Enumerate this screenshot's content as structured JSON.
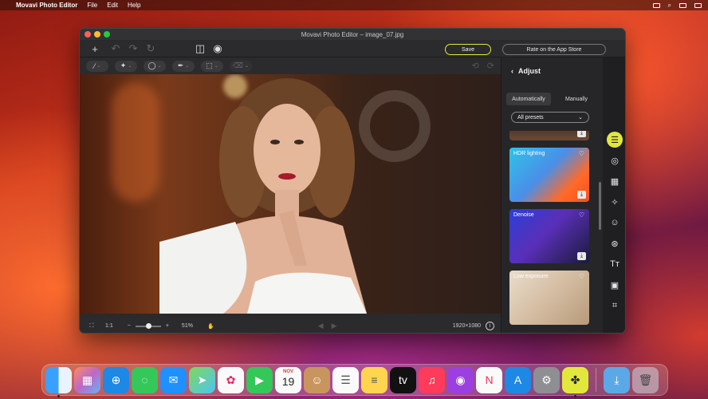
{
  "menubar": {
    "app_name": "Movavi Photo Editor",
    "items": [
      "File",
      "Edit",
      "Help"
    ]
  },
  "window": {
    "title": "Movavi Photo Editor – image_07.jpg"
  },
  "toolbar": {
    "save_label": "Save",
    "rate_label": "Rate on the App Store"
  },
  "statusbar": {
    "ratio": "1:1",
    "zoom_minus": "−",
    "zoom_plus": "+",
    "zoom_percent": "51%",
    "resolution": "1920×1080",
    "zoom_fraction": 0.51
  },
  "panel": {
    "title": "Adjust",
    "tabs": [
      "Automatically",
      "Manually"
    ],
    "active_tab": "Automatically",
    "preset_select": "All presets",
    "presets": [
      {
        "name": "HDR lighting"
      },
      {
        "name": "Denoise"
      },
      {
        "name": "Low exposure"
      }
    ]
  },
  "sidebar_icons": [
    "adjust-icon",
    "retouch-icon",
    "background-icon",
    "magic-icon",
    "face-icon",
    "filters-icon",
    "text-icon",
    "overlay-icon",
    "crop-icon"
  ],
  "dock": {
    "calendar_month": "NOV",
    "calendar_day": "19"
  },
  "colors": {
    "accent": "#e2e83b",
    "panel_bg": "#262628",
    "window_bg": "#2a2a2c"
  }
}
